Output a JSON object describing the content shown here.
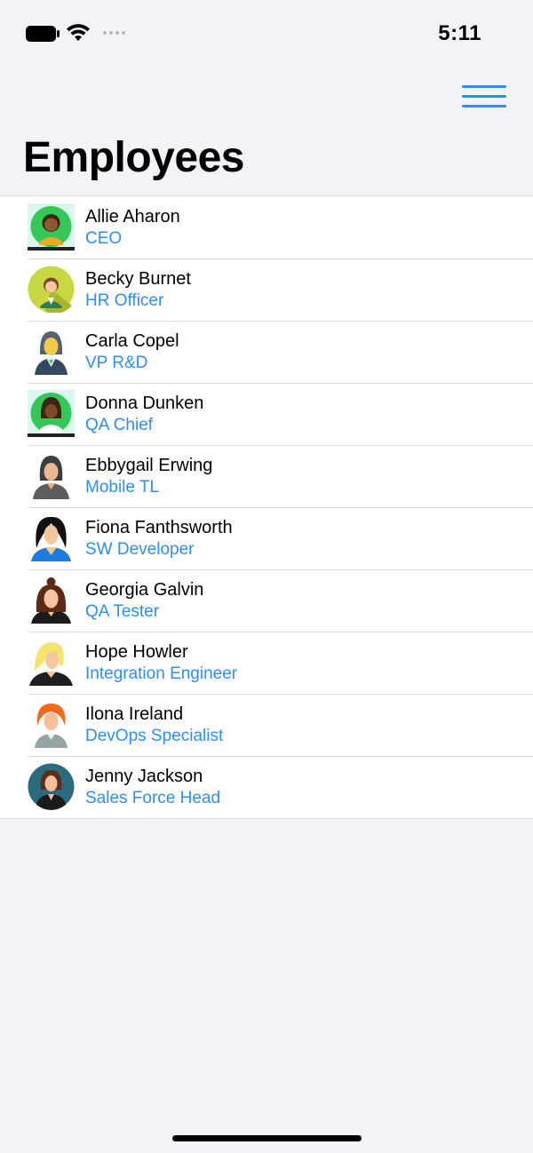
{
  "status_bar": {
    "time": "5:11"
  },
  "nav": {
    "title": "Employees",
    "menu_icon": "hamburger-menu-icon",
    "accent_color": "#2f8ef2"
  },
  "employees": [
    {
      "name": "Allie Aharon",
      "role": "CEO",
      "avatar_icon": "woman-avatar-green-circle"
    },
    {
      "name": "Becky Burnet",
      "role": "HR Officer",
      "avatar_icon": "woman-avatar-yellow-circle"
    },
    {
      "name": "Carla Copel",
      "role": "VP R&D",
      "avatar_icon": "woman-avatar-gray"
    },
    {
      "name": "Donna Dunken",
      "role": "QA Chief",
      "avatar_icon": "woman-avatar-green-circle-braids"
    },
    {
      "name": "Ebbygail Erwing",
      "role": "Mobile TL",
      "avatar_icon": "woman-avatar-dark-hair"
    },
    {
      "name": "Fiona Fanthsworth",
      "role": "SW Developer",
      "avatar_icon": "woman-avatar-black-hair-blue"
    },
    {
      "name": "Georgia Galvin",
      "role": "QA Tester",
      "avatar_icon": "woman-avatar-brown-bun"
    },
    {
      "name": "Hope Howler",
      "role": "Integration Engineer",
      "avatar_icon": "woman-avatar-blonde"
    },
    {
      "name": "Ilona Ireland",
      "role": "DevOps Specialist",
      "avatar_icon": "woman-avatar-redhead"
    },
    {
      "name": "Jenny Jackson",
      "role": "Sales Force Head",
      "avatar_icon": "woman-avatar-teal-circle"
    }
  ]
}
